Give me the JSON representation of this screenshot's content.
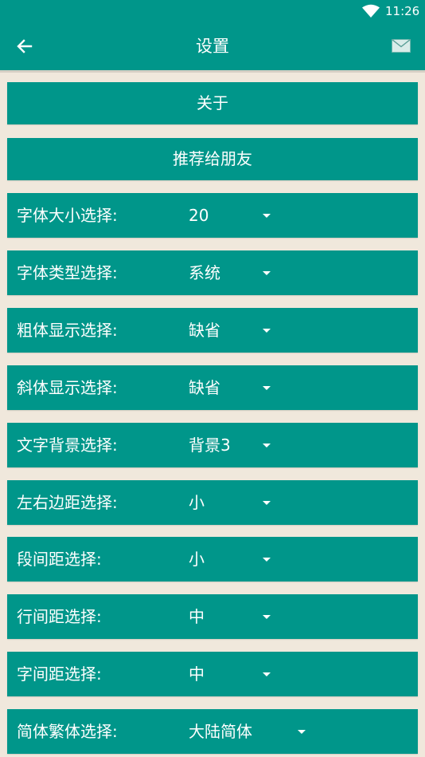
{
  "status_bar": {
    "time": "11:26",
    "wifi_icon": "wifi-icon"
  },
  "toolbar": {
    "title": "设置",
    "back_icon": "arrow-left-icon",
    "mail_icon": "mail-icon"
  },
  "buttons": {
    "about": "关于",
    "recommend": "推荐给朋友"
  },
  "settings": [
    {
      "label": "字体大小选择:",
      "value": "20"
    },
    {
      "label": "字体类型选择:",
      "value": "系统"
    },
    {
      "label": "粗体显示选择:",
      "value": "缺省"
    },
    {
      "label": "斜体显示选择:",
      "value": "缺省"
    },
    {
      "label": "文字背景选择:",
      "value": "背景3"
    },
    {
      "label": "左右边距选择:",
      "value": "小"
    },
    {
      "label": "段间距选择:",
      "value": "小"
    },
    {
      "label": "行间距选择:",
      "value": "中"
    },
    {
      "label": "字间距选择:",
      "value": "中"
    },
    {
      "label": "简体繁体选择:",
      "value": "大陆简体"
    }
  ],
  "colors": {
    "primary": "#00968a",
    "background": "#f0e8dc",
    "text": "#ffffff"
  }
}
